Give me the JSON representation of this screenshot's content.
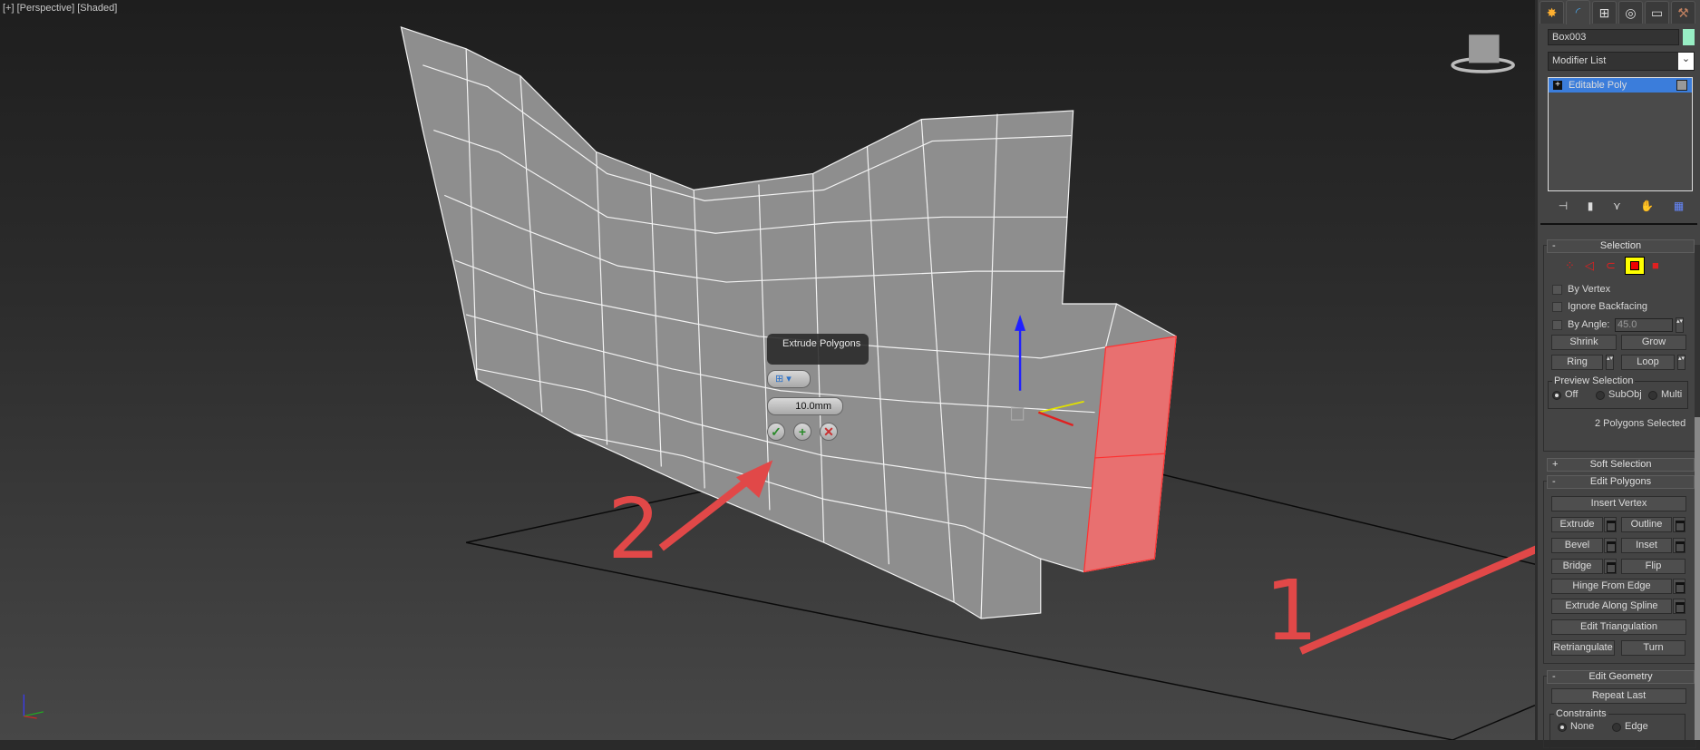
{
  "viewport": {
    "label": "[+] [Perspective] [Shaded]",
    "caddy": {
      "title": "Extrude Polygons",
      "height_value": "10.0mm",
      "ok": "✓",
      "apply": "+",
      "cancel": "✕"
    },
    "annotations": [
      "1",
      "2"
    ],
    "colors": {
      "selected_face": "#e87070",
      "arrow": "#e14848"
    }
  },
  "panel": {
    "tabs": [
      {
        "icon": "create-icon",
        "glyph": "✸"
      },
      {
        "icon": "modify-icon",
        "glyph": "◜"
      },
      {
        "icon": "hierarchy-icon",
        "glyph": "⊞"
      },
      {
        "icon": "motion-icon",
        "glyph": "◎"
      },
      {
        "icon": "display-icon",
        "glyph": "▭"
      },
      {
        "icon": "utilities-icon",
        "glyph": "⚒"
      }
    ],
    "object_name": "Box003",
    "object_color": "#98eec4",
    "modifier_list": "Modifier List",
    "stack": [
      {
        "label": "Editable Poly",
        "toggle": "+"
      }
    ],
    "selection": {
      "title": "Selection",
      "collapse": "-",
      "by_vertex": "By Vertex",
      "ignore_backfacing": "Ignore Backfacing",
      "by_angle": "By Angle:",
      "angle_value": "45.0",
      "shrink": "Shrink",
      "grow": "Grow",
      "ring": "Ring",
      "loop": "Loop",
      "preview_title": "Preview Selection",
      "preview_options": [
        "Off",
        "SubObj",
        "Multi"
      ],
      "preview_selected": "Off",
      "status": "2 Polygons Selected"
    },
    "soft_selection": {
      "title": "Soft Selection",
      "collapse": "+"
    },
    "edit_polygons": {
      "title": "Edit Polygons",
      "collapse": "-",
      "insert_vertex": "Insert Vertex",
      "extrude": "Extrude",
      "outline": "Outline",
      "bevel": "Bevel",
      "inset": "Inset",
      "bridge": "Bridge",
      "flip": "Flip",
      "hinge": "Hinge From Edge",
      "extrude_spline": "Extrude Along Spline",
      "edit_tri": "Edit Triangulation",
      "retri": "Retriangulate",
      "turn": "Turn"
    },
    "edit_geometry": {
      "title": "Edit Geometry",
      "collapse": "-",
      "repeat_last": "Repeat Last",
      "constraints": "Constraints",
      "options": [
        "None",
        "Edge"
      ],
      "selected": "None"
    }
  }
}
